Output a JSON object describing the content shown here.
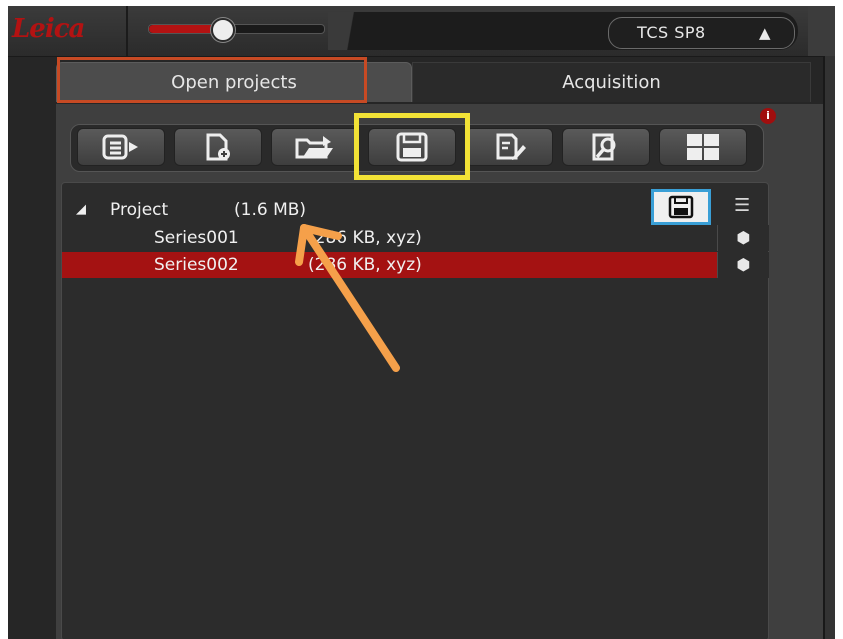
{
  "brand": {
    "logo_text": "Leica"
  },
  "header": {
    "zoom_slider": {
      "value_fraction": 0.42
    },
    "system_select": {
      "value": "TCS SP8",
      "arrow_icon": "updown-arrows-icon"
    }
  },
  "tabs": [
    {
      "label": "Open projects",
      "active": true
    },
    {
      "label": "Acquisition",
      "active": false
    }
  ],
  "notification": {
    "label": "i",
    "color": "#a00e0e"
  },
  "toolbar": {
    "buttons": [
      {
        "icon": "export-list-icon"
      },
      {
        "icon": "new-project-icon"
      },
      {
        "icon": "open-folder-icon"
      },
      {
        "icon": "save-icon"
      },
      {
        "icon": "rename-icon"
      },
      {
        "icon": "find-icon"
      },
      {
        "icon": "layout-grid-icon"
      }
    ]
  },
  "tree": {
    "project": {
      "expander": "◢",
      "name": "Project",
      "size": "(1.6 MB)"
    },
    "series": [
      {
        "name": "Series001",
        "info": "(286 KB, xyz)",
        "selected": false
      },
      {
        "name": "Series002",
        "info": "(286 KB, xyz)",
        "selected": true
      }
    ]
  },
  "annotations": {
    "highlight_colors": {
      "red": "#c74a24",
      "yellow": "#f2e236",
      "blue": "#3a9fd6"
    },
    "arrow_color": "#f5a04a"
  },
  "colors": {
    "accent": "#b31212",
    "selection": "#a41212",
    "panel": "#2c2c2c"
  }
}
